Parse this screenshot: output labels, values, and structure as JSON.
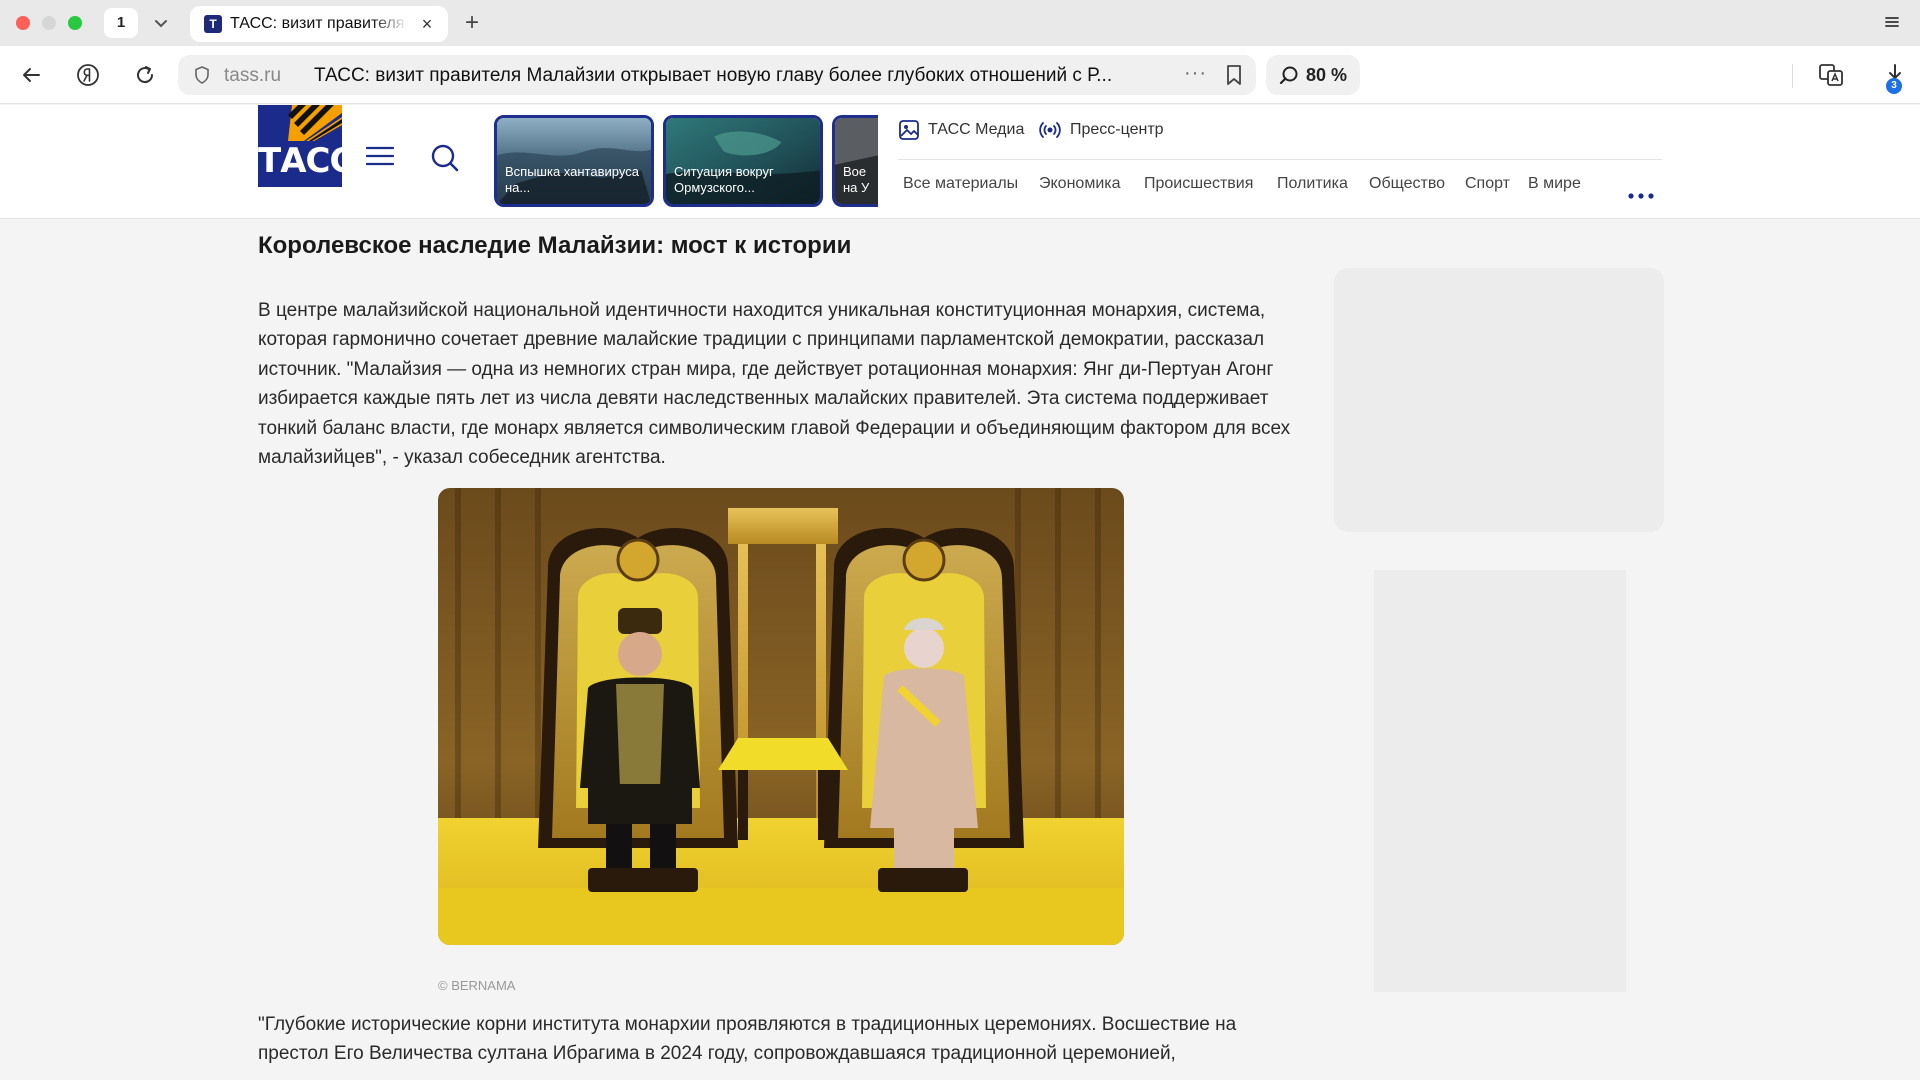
{
  "browser": {
    "tab_count": "1",
    "active_tab_title": "ТАСС: визит правителя Малайзии",
    "favicon_letter": "T",
    "address_domain": "tass.ru",
    "address_title": "ТАСС: визит правителя Малайзии открывает новую главу более глубоких отношений с Р...",
    "zoom": "80 %",
    "downloads_badge": "3"
  },
  "site": {
    "logo_text": "ТАСС",
    "stories": [
      {
        "label": "Вспышка хантавируса на..."
      },
      {
        "label": "Ситуация вокруг Ормузского..."
      },
      {
        "label": "Вое на У"
      }
    ],
    "media_links": [
      {
        "label": "ТАСС Медиа",
        "icon": "image-icon"
      },
      {
        "label": "Пресс-центр",
        "icon": "broadcast-icon"
      }
    ],
    "categories": [
      "Все материалы",
      "Экономика",
      "Происшествия",
      "Политика",
      "Общество",
      "Спорт",
      "В мире"
    ]
  },
  "article": {
    "heading": "Королевское наследие Малайзии: мост к истории",
    "paragraph1": "В центре малайзийской национальной идентичности находится уникальная конституционная монархия, система, которая гармонично сочетает древние малайские традиции с принципами парламентской демократии, рассказал источник. \"Малайзия — одна из немногих стран мира, где действует ротационная монархия: Янг ди-Пертуан Агонг избирается каждые пять лет из числа девяти наследственных малайских правителей. Эта система поддерживает тонкий баланс власти, где монарх является символическим главой Федерации и объединяющим фактором для всех малайзийцев\", - указал собеседник агентства.",
    "photo_credit": "© BERNAMA",
    "paragraph2": "\"Глубокие исторические корни института монархии проявляются в традиционных церемониях. Восшествие на престол Его Величества султана Ибрагима в 2024 году, сопровождавшаяся традиционной церемонией,"
  },
  "colors": {
    "brand_blue": "#1b2b8c",
    "accent_blue": "#1f6fe5",
    "page_bg": "#f4f4f4"
  }
}
